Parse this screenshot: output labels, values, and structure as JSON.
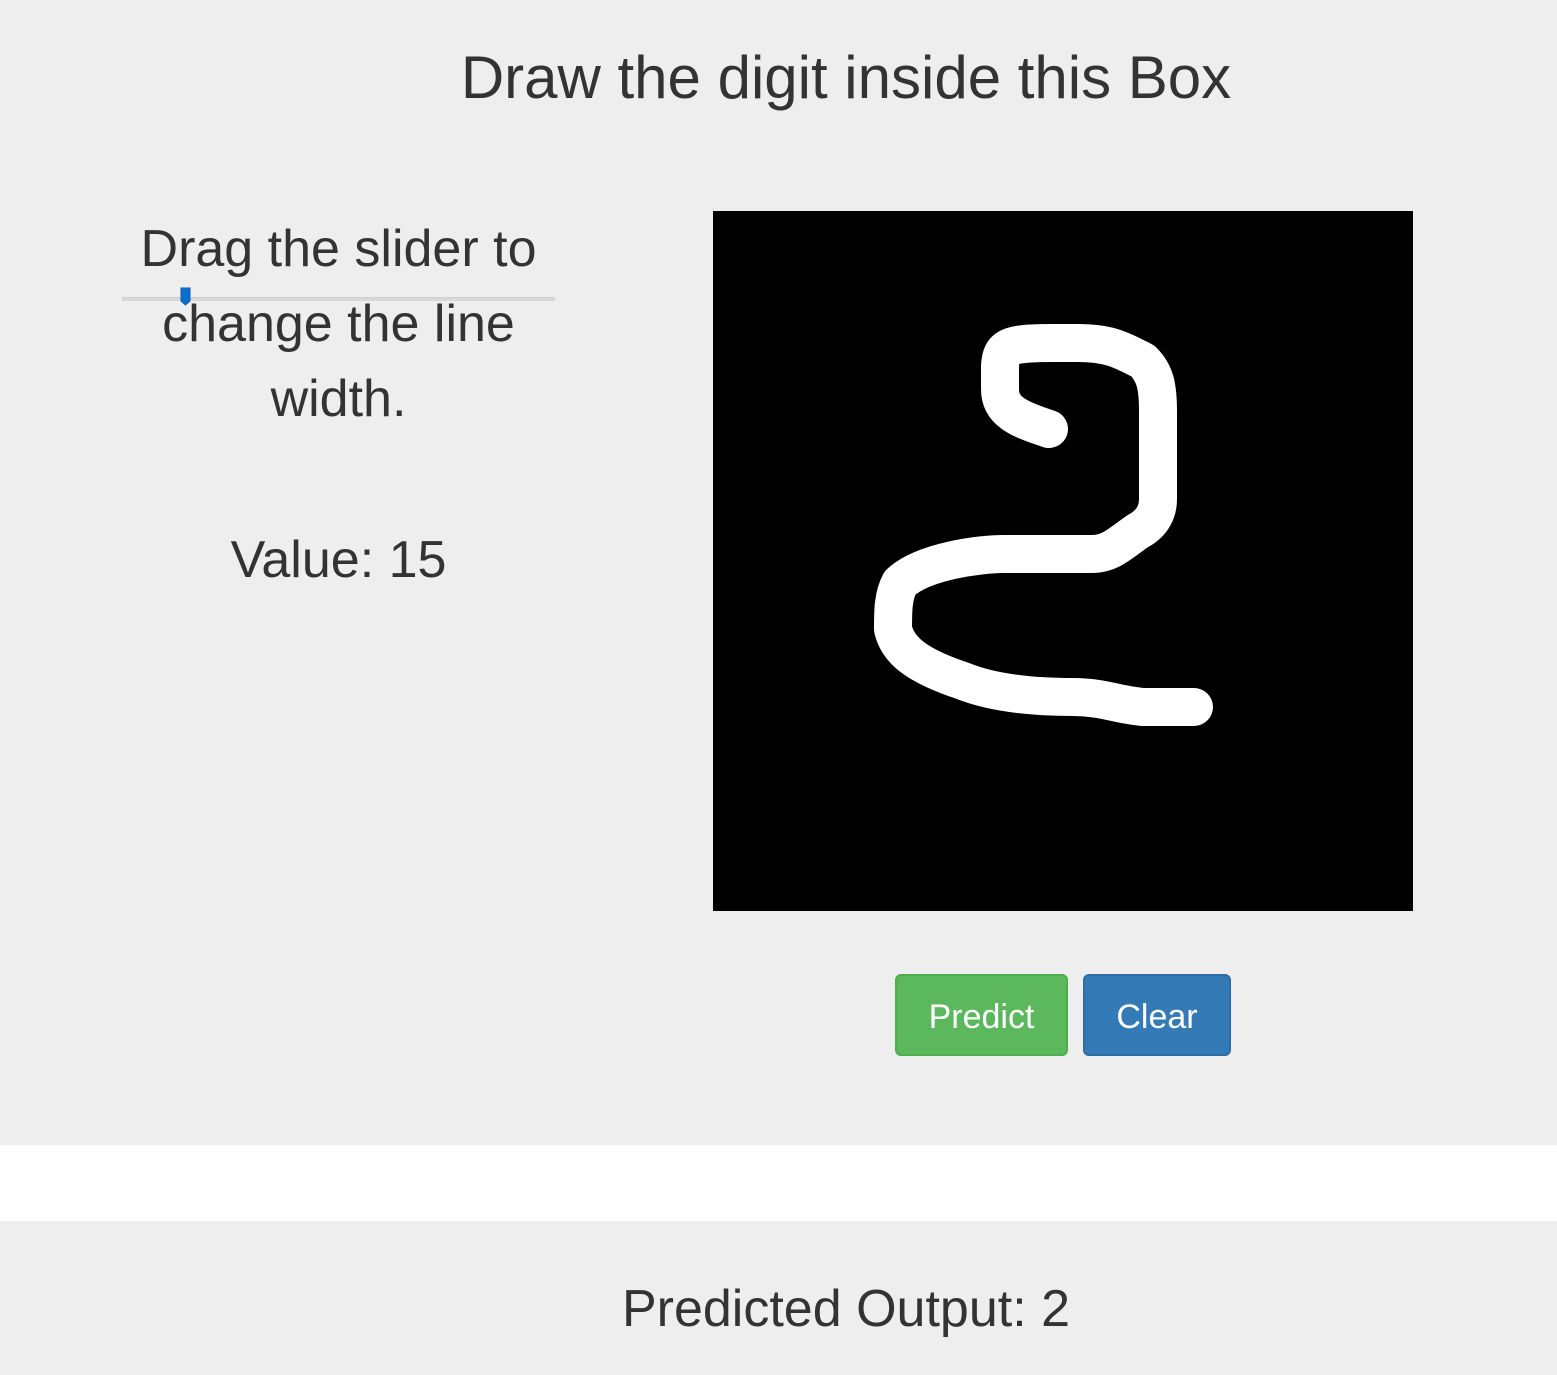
{
  "header": {
    "title": "Draw the digit inside this Box"
  },
  "controls": {
    "instructions": "Drag the slider to change the line width.",
    "slider": {
      "value": 15,
      "min": 1,
      "max": 100,
      "accent_color": "#0c6fcf"
    },
    "value_prefix": "Value: ",
    "value_text": "15"
  },
  "canvas": {
    "background": "#000000",
    "stroke_color": "#ffffff",
    "drawn_digit_icon": "handwritten-2"
  },
  "buttons": {
    "predict_label": "Predict",
    "predict_color": "#5cb85c",
    "clear_label": "Clear",
    "clear_color": "#337ab7"
  },
  "result": {
    "prefix": "Predicted Output: ",
    "value": "2"
  }
}
